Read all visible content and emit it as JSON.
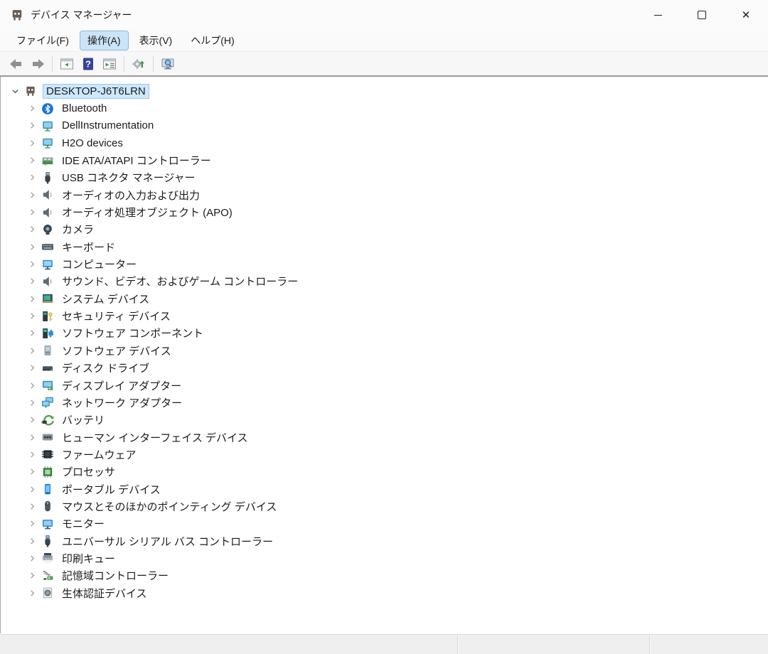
{
  "window": {
    "title": "デバイス マネージャー",
    "app_icon": "device-manager-icon"
  },
  "menu": {
    "items": [
      {
        "label": "ファイル(F)",
        "active": false
      },
      {
        "label": "操作(A)",
        "active": true
      },
      {
        "label": "表示(V)",
        "active": false
      },
      {
        "label": "ヘルプ(H)",
        "active": false
      }
    ]
  },
  "toolbar": {
    "buttons": [
      {
        "name": "back-button",
        "icon": "back-arrow-icon"
      },
      {
        "name": "forward-button",
        "icon": "forward-arrow-icon"
      },
      {
        "name": "separator"
      },
      {
        "name": "console-tree-toggle-button",
        "icon": "panel-left-window-icon"
      },
      {
        "name": "help-button",
        "icon": "help-question-icon"
      },
      {
        "name": "action-pane-toggle-button",
        "icon": "panel-list-window-icon"
      },
      {
        "name": "separator"
      },
      {
        "name": "update-driver-button",
        "icon": "gear-green-arrow-icon"
      },
      {
        "name": "separator"
      },
      {
        "name": "scan-hardware-changes-button",
        "icon": "monitor-magnifier-icon"
      }
    ]
  },
  "tree": {
    "root": {
      "label": "DESKTOP-J6T6LRN",
      "icon": "computer-device-icon",
      "expanded": true,
      "selected": true
    },
    "items": [
      {
        "label": "Bluetooth",
        "icon": "bluetooth-icon"
      },
      {
        "label": "DellInstrumentation",
        "icon": "network-monitor-icon"
      },
      {
        "label": "H2O devices",
        "icon": "network-monitor-icon"
      },
      {
        "label": "IDE ATA/ATAPI コントローラー",
        "icon": "ide-controller-icon"
      },
      {
        "label": "USB コネクタ マネージャー",
        "icon": "usb-plug-icon"
      },
      {
        "label": "オーディオの入力および出力",
        "icon": "speaker-icon"
      },
      {
        "label": "オーディオ処理オブジェクト (APO)",
        "icon": "speaker-icon"
      },
      {
        "label": "カメラ",
        "icon": "camera-icon"
      },
      {
        "label": "キーボード",
        "icon": "keyboard-icon"
      },
      {
        "label": "コンピューター",
        "icon": "computer-monitor-icon"
      },
      {
        "label": "サウンド、ビデオ、およびゲーム コントローラー",
        "icon": "speaker-icon"
      },
      {
        "label": "システム デバイス",
        "icon": "system-device-icon"
      },
      {
        "label": "セキュリティ デバイス",
        "icon": "security-device-icon"
      },
      {
        "label": "ソフトウェア コンポーネント",
        "icon": "software-component-icon"
      },
      {
        "label": "ソフトウェア デバイス",
        "icon": "software-device-icon"
      },
      {
        "label": "ディスク ドライブ",
        "icon": "disk-drive-icon"
      },
      {
        "label": "ディスプレイ アダプター",
        "icon": "display-adapter-icon"
      },
      {
        "label": "ネットワーク アダプター",
        "icon": "network-adapter-icon"
      },
      {
        "label": "バッテリ",
        "icon": "battery-icon"
      },
      {
        "label": "ヒューマン インターフェイス デバイス",
        "icon": "hid-icon"
      },
      {
        "label": "ファームウェア",
        "icon": "firmware-icon"
      },
      {
        "label": "プロセッサ",
        "icon": "processor-icon"
      },
      {
        "label": "ポータブル デバイス",
        "icon": "portable-device-icon"
      },
      {
        "label": "マウスとそのほかのポインティング デバイス",
        "icon": "mouse-icon"
      },
      {
        "label": "モニター",
        "icon": "monitor-icon"
      },
      {
        "label": "ユニバーサル シリアル バス コントローラー",
        "icon": "usb-plug-icon"
      },
      {
        "label": "印刷キュー",
        "icon": "printer-icon"
      },
      {
        "label": "記憶域コントローラー",
        "icon": "storage-controller-icon"
      },
      {
        "label": "生体認証デバイス",
        "icon": "biometric-icon"
      }
    ]
  },
  "colors": {
    "selection_bg": "#cbe8ff",
    "menu_active_bg": "#cce4f7",
    "toolbar_border": "#9b9b9b",
    "bottom_strip_bg": "#efefef"
  }
}
